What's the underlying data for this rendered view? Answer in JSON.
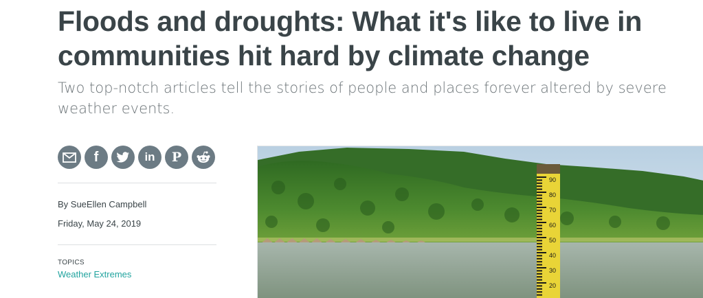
{
  "article": {
    "headline": "Floods and droughts: What it's like to live in communities hit hard by climate change",
    "dek": "Two top-notch articles tell the stories of people and places forever altered by severe weather events.",
    "byline": "By SueEllen Campbell",
    "date": "Friday, May 24, 2019",
    "topics_label": "TOPICS",
    "topics": [
      "Weather Extremes"
    ]
  },
  "share": {
    "buttons": [
      {
        "icon": "mail-icon"
      },
      {
        "icon": "facebook-icon",
        "glyph": "f"
      },
      {
        "icon": "twitter-icon"
      },
      {
        "icon": "linkedin-icon",
        "glyph": "in"
      },
      {
        "icon": "pinterest-icon",
        "glyph": "P"
      },
      {
        "icon": "reddit-icon"
      }
    ],
    "color": "#6c7b84"
  },
  "hero_image": {
    "gauge_labels": [
      "90",
      "80",
      "70",
      "60",
      "50",
      "40",
      "30",
      "20"
    ],
    "colors": {
      "sky": "#cfe0ec",
      "forest": "#3f7a2a",
      "water": "#8a9c8c",
      "gauge": "#e9d437"
    }
  },
  "colors": {
    "link": "#20a39e",
    "headline": "#3a4448",
    "dek": "#6c7478"
  }
}
